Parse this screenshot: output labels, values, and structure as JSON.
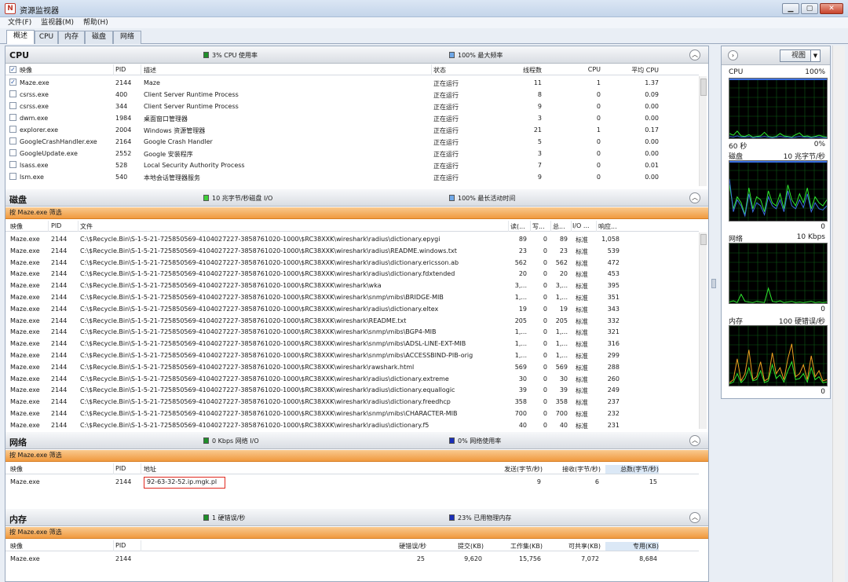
{
  "window": {
    "title": "资源监视器",
    "icon": "resmon-app-icon"
  },
  "menu": [
    "文件(F)",
    "监视器(M)",
    "帮助(H)"
  ],
  "tabs": [
    "概述",
    "CPU",
    "内存",
    "磁盘",
    "网络"
  ],
  "cpu": {
    "title": "CPU",
    "indicator1": "3% CPU 使用率",
    "indicator1_color": "#1f8f2a",
    "indicator2": "100% 最大频率",
    "indicator2_color": "#6fa8e8",
    "columns": [
      "映像",
      "PID",
      "描述",
      "状态",
      "线程数",
      "CPU",
      "平均 CPU"
    ],
    "rows": [
      {
        "image": "Maze.exe",
        "pid": "2144",
        "desc": "Maze",
        "status": "正在运行",
        "threads": "11",
        "cpu": "1",
        "avg": "1.37",
        "checked": "✓"
      },
      {
        "image": "csrss.exe",
        "pid": "400",
        "desc": "Client Server Runtime Process",
        "status": "正在运行",
        "threads": "8",
        "cpu": "0",
        "avg": "0.09",
        "checked": ""
      },
      {
        "image": "csrss.exe",
        "pid": "344",
        "desc": "Client Server Runtime Process",
        "status": "正在运行",
        "threads": "9",
        "cpu": "0",
        "avg": "0.00",
        "checked": ""
      },
      {
        "image": "dwm.exe",
        "pid": "1984",
        "desc": "桌面窗口管理器",
        "status": "正在运行",
        "threads": "3",
        "cpu": "0",
        "avg": "0.00",
        "checked": ""
      },
      {
        "image": "explorer.exe",
        "pid": "2004",
        "desc": "Windows 资源管理器",
        "status": "正在运行",
        "threads": "21",
        "cpu": "1",
        "avg": "0.17",
        "checked": ""
      },
      {
        "image": "GoogleCrashHandler.exe",
        "pid": "2164",
        "desc": "Google Crash Handler",
        "status": "正在运行",
        "threads": "5",
        "cpu": "0",
        "avg": "0.00",
        "checked": ""
      },
      {
        "image": "GoogleUpdate.exe",
        "pid": "2552",
        "desc": "Google 安装程序",
        "status": "正在运行",
        "threads": "3",
        "cpu": "0",
        "avg": "0.00",
        "checked": ""
      },
      {
        "image": "lsass.exe",
        "pid": "528",
        "desc": "Local Security Authority Process",
        "status": "正在运行",
        "threads": "7",
        "cpu": "0",
        "avg": "0.01",
        "checked": ""
      },
      {
        "image": "lsm.exe",
        "pid": "540",
        "desc": "本地会话管理器服务",
        "status": "正在运行",
        "threads": "9",
        "cpu": "0",
        "avg": "0.00",
        "checked": ""
      }
    ]
  },
  "disk": {
    "title": "磁盘",
    "indicator1": "10 兆字节/秒磁盘 I/O",
    "indicator1_color": "#3fcf3a",
    "indicator2": "100% 最长活动时间",
    "indicator2_color": "#6fa8e8",
    "filter": "按 Maze.exe 筛选",
    "columns": [
      "映像",
      "PID",
      "文件",
      "读(...",
      "写...",
      "总...",
      "I/O ...",
      "响应..."
    ],
    "path_prefix": "C:\\$Recycle.Bin\\S-1-5-21-725850569-4104027227-3858761020-1000\\$RC38XXK\\",
    "rows": [
      {
        "image": "Maze.exe",
        "pid": "2144",
        "file": "wireshark\\radius\\dictionary.epygi",
        "read": "89",
        "write": "0",
        "total": "89",
        "io": "标准",
        "resp": "1,058"
      },
      {
        "image": "Maze.exe",
        "pid": "2144",
        "file": "wireshark\\radius\\README.windows.txt",
        "read": "23",
        "write": "0",
        "total": "23",
        "io": "标准",
        "resp": "539"
      },
      {
        "image": "Maze.exe",
        "pid": "2144",
        "file": "wireshark\\radius\\dictionary.ericsson.ab",
        "read": "562",
        "write": "0",
        "total": "562",
        "io": "标准",
        "resp": "472"
      },
      {
        "image": "Maze.exe",
        "pid": "2144",
        "file": "wireshark\\radius\\dictionary.fdxtended",
        "read": "20",
        "write": "0",
        "total": "20",
        "io": "标准",
        "resp": "453"
      },
      {
        "image": "Maze.exe",
        "pid": "2144",
        "file": "wireshark\\wka",
        "read": "3,...",
        "write": "0",
        "total": "3,...",
        "io": "标准",
        "resp": "395"
      },
      {
        "image": "Maze.exe",
        "pid": "2144",
        "file": "wireshark\\snmp\\mibs\\BRIDGE-MIB",
        "read": "1,...",
        "write": "0",
        "total": "1,...",
        "io": "标准",
        "resp": "351"
      },
      {
        "image": "Maze.exe",
        "pid": "2144",
        "file": "wireshark\\radius\\dictionary.eltex",
        "read": "19",
        "write": "0",
        "total": "19",
        "io": "标准",
        "resp": "343"
      },
      {
        "image": "Maze.exe",
        "pid": "2144",
        "file": "wireshark\\README.txt",
        "read": "205",
        "write": "0",
        "total": "205",
        "io": "标准",
        "resp": "332"
      },
      {
        "image": "Maze.exe",
        "pid": "2144",
        "file": "wireshark\\snmp\\mibs\\BGP4-MIB",
        "read": "1,...",
        "write": "0",
        "total": "1,...",
        "io": "标准",
        "resp": "321"
      },
      {
        "image": "Maze.exe",
        "pid": "2144",
        "file": "wireshark\\snmp\\mibs\\ADSL-LINE-EXT-MIB",
        "read": "1,...",
        "write": "0",
        "total": "1,...",
        "io": "标准",
        "resp": "316"
      },
      {
        "image": "Maze.exe",
        "pid": "2144",
        "file": "wireshark\\snmp\\mibs\\ACCESSBIND-PIB-orig",
        "read": "1,...",
        "write": "0",
        "total": "1,...",
        "io": "标准",
        "resp": "299"
      },
      {
        "image": "Maze.exe",
        "pid": "2144",
        "file": "wireshark\\rawshark.html",
        "read": "569",
        "write": "0",
        "total": "569",
        "io": "标准",
        "resp": "288"
      },
      {
        "image": "Maze.exe",
        "pid": "2144",
        "file": "wireshark\\radius\\dictionary.extreme",
        "read": "30",
        "write": "0",
        "total": "30",
        "io": "标准",
        "resp": "260"
      },
      {
        "image": "Maze.exe",
        "pid": "2144",
        "file": "wireshark\\radius\\dictionary.equallogic",
        "read": "39",
        "write": "0",
        "total": "39",
        "io": "标准",
        "resp": "249"
      },
      {
        "image": "Maze.exe",
        "pid": "2144",
        "file": "wireshark\\radius\\dictionary.freedhcp",
        "read": "358",
        "write": "0",
        "total": "358",
        "io": "标准",
        "resp": "237"
      },
      {
        "image": "Maze.exe",
        "pid": "2144",
        "file": "wireshark\\snmp\\mibs\\CHARACTER-MIB",
        "read": "700",
        "write": "0",
        "total": "700",
        "io": "标准",
        "resp": "232"
      },
      {
        "image": "Maze.exe",
        "pid": "2144",
        "file": "wireshark\\radius\\dictionary.f5",
        "read": "40",
        "write": "0",
        "total": "40",
        "io": "标准",
        "resp": "231"
      }
    ]
  },
  "network": {
    "title": "网络",
    "indicator1": "0 Kbps 网络 I/O",
    "indicator1_color": "#1f8f2a",
    "indicator2": "0% 网络使用率",
    "indicator2_color": "#1a2fb8",
    "filter": "按 Maze.exe 筛选",
    "columns": [
      "映像",
      "PID",
      "地址",
      "发送(字节/秒)",
      "接收(字节/秒)",
      "总数(字节/秒)"
    ],
    "rows": [
      {
        "image": "Maze.exe",
        "pid": "2144",
        "addr": "92-63-32-52.ip.mgk.pl",
        "send": "9",
        "recv": "6",
        "total": "15"
      }
    ]
  },
  "memory": {
    "title": "内存",
    "indicator1": "1 硬错误/秒",
    "indicator1_color": "#1f8f2a",
    "indicator2": "23% 已用物理内存",
    "indicator2_color": "#1a2fb8",
    "filter": "按 Maze.exe 筛选",
    "columns": [
      "映像",
      "PID",
      "硬错误/秒",
      "提交(KB)",
      "工作集(KB)",
      "可共享(KB)",
      "专用(KB)"
    ],
    "rows": [
      {
        "image": "Maze.exe",
        "pid": "2144",
        "hard": "25",
        "commit": "9,620",
        "ws": "15,756",
        "share": "7,072",
        "priv": "8,684"
      }
    ]
  },
  "side": {
    "view_label": "视图",
    "graphs": [
      {
        "name": "CPU",
        "max": "100%",
        "min_left": "60 秒",
        "min_right": "0%",
        "line_colors": [
          "#2ee82e",
          "#3a6fe0"
        ]
      },
      {
        "name": "磁盘",
        "max": "10 兆字节/秒",
        "min_left": "",
        "min_right": "0",
        "line_colors": [
          "#2ee82e",
          "#3a6fe0"
        ]
      },
      {
        "name": "网络",
        "max": "10 Kbps",
        "min_left": "",
        "min_right": "0",
        "line_colors": [
          "#2ee82e"
        ]
      },
      {
        "name": "内存",
        "max": "100 硬错误/秒",
        "min_left": "",
        "min_right": "0",
        "line_colors": [
          "#f0a020",
          "#2ee82e"
        ]
      }
    ]
  }
}
